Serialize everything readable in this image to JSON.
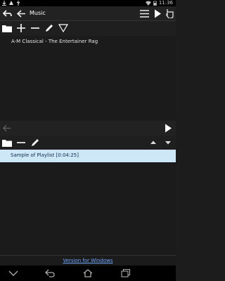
{
  "app": {
    "title": "Music"
  },
  "status": {
    "time": "11:36"
  },
  "tracks": [
    {
      "label": "A-M Classical - The Entertainer Rag"
    }
  ],
  "playlists": [
    {
      "label": "Sample of Playlist [0:04:25]"
    }
  ],
  "footer": {
    "link_text": "Version for Windows"
  },
  "colors": {
    "background": "#1b1b1b",
    "selected_row": "#cde7f7",
    "link": "#6ea5ff"
  },
  "icons": [
    "back-arrow-icon",
    "menu-icon",
    "play-icon",
    "select-icon",
    "folder-icon",
    "add-icon",
    "remove-icon",
    "edit-icon",
    "filter-icon",
    "move-up-icon",
    "move-down-icon",
    "nav-back-icon",
    "nav-home-icon",
    "nav-recents-icon"
  ]
}
